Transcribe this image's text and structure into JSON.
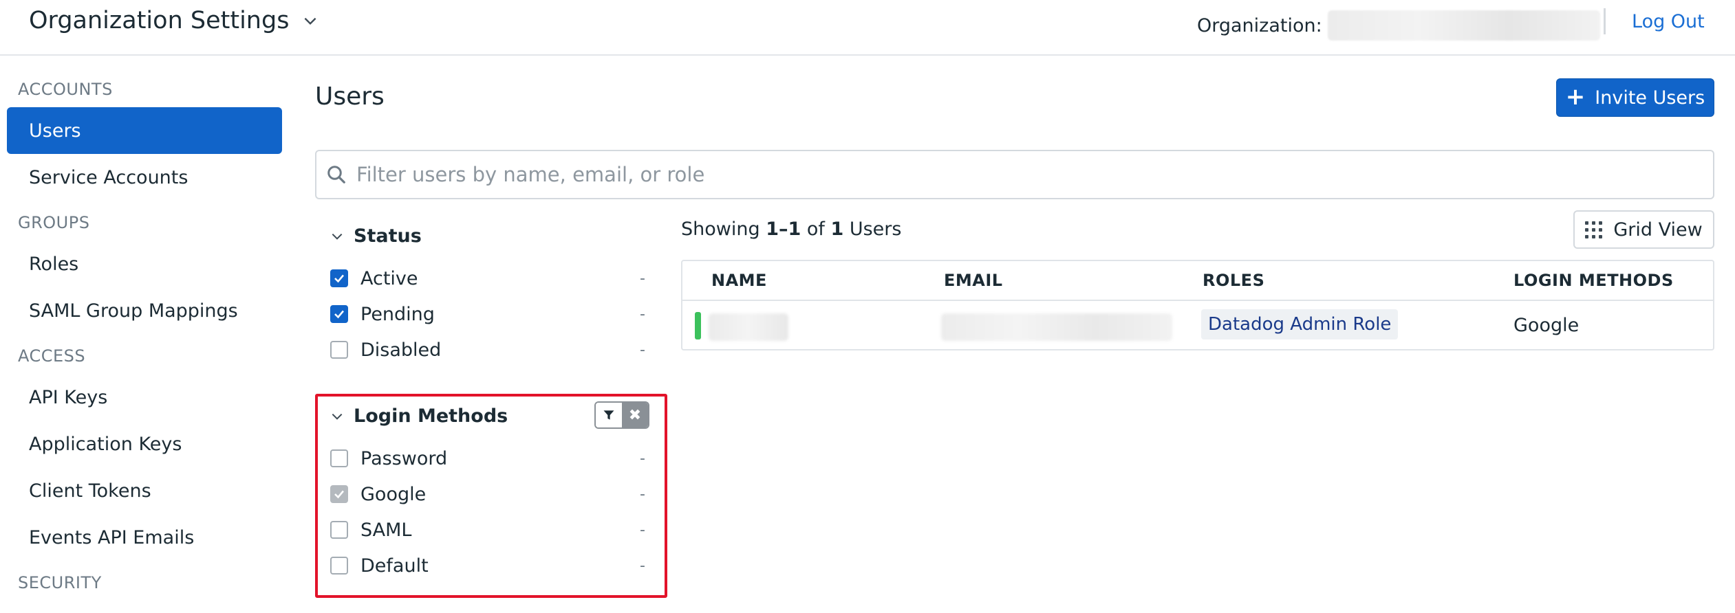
{
  "header": {
    "title": "Organization Settings",
    "org_label": "Organization:",
    "logout_label": "Log Out"
  },
  "sidebar": {
    "sections": [
      {
        "title": "ACCOUNTS",
        "items": [
          {
            "label": "Users",
            "active": true
          },
          {
            "label": "Service Accounts"
          }
        ]
      },
      {
        "title": "GROUPS",
        "items": [
          {
            "label": "Roles"
          },
          {
            "label": "SAML Group Mappings"
          }
        ]
      },
      {
        "title": "ACCESS",
        "items": [
          {
            "label": "API Keys"
          },
          {
            "label": "Application Keys"
          },
          {
            "label": "Client Tokens"
          },
          {
            "label": "Events API Emails"
          }
        ]
      },
      {
        "title": "SECURITY",
        "items": []
      }
    ]
  },
  "main": {
    "title": "Users",
    "invite_label": "Invite Users",
    "search_placeholder": "Filter users by name, email, or role"
  },
  "facets": {
    "status": {
      "title": "Status",
      "options": [
        {
          "label": "Active",
          "checked": true,
          "count": "-"
        },
        {
          "label": "Pending",
          "checked": true,
          "count": "-"
        },
        {
          "label": "Disabled",
          "checked": false,
          "count": "-"
        }
      ]
    },
    "login_methods": {
      "title": "Login Methods",
      "options": [
        {
          "label": "Password",
          "checked": false,
          "count": "-"
        },
        {
          "label": "Google",
          "checked": true,
          "count": "-"
        },
        {
          "label": "SAML",
          "checked": false,
          "count": "-"
        },
        {
          "label": "Default",
          "checked": false,
          "count": "-"
        }
      ]
    }
  },
  "results": {
    "showing_prefix": "Showing ",
    "range": "1–1",
    "of": " of ",
    "total": "1",
    "suffix": " Users",
    "grid_view_label": "Grid View",
    "columns": [
      "NAME",
      "EMAIL",
      "ROLES",
      "LOGIN METHODS"
    ],
    "rows": [
      {
        "role": "Datadog Admin Role",
        "login_method": "Google",
        "status_color": "#3cc15c"
      }
    ]
  },
  "colors": {
    "accent": "#1164c9",
    "highlight": "#e2132a",
    "status_active": "#3cc15c"
  }
}
